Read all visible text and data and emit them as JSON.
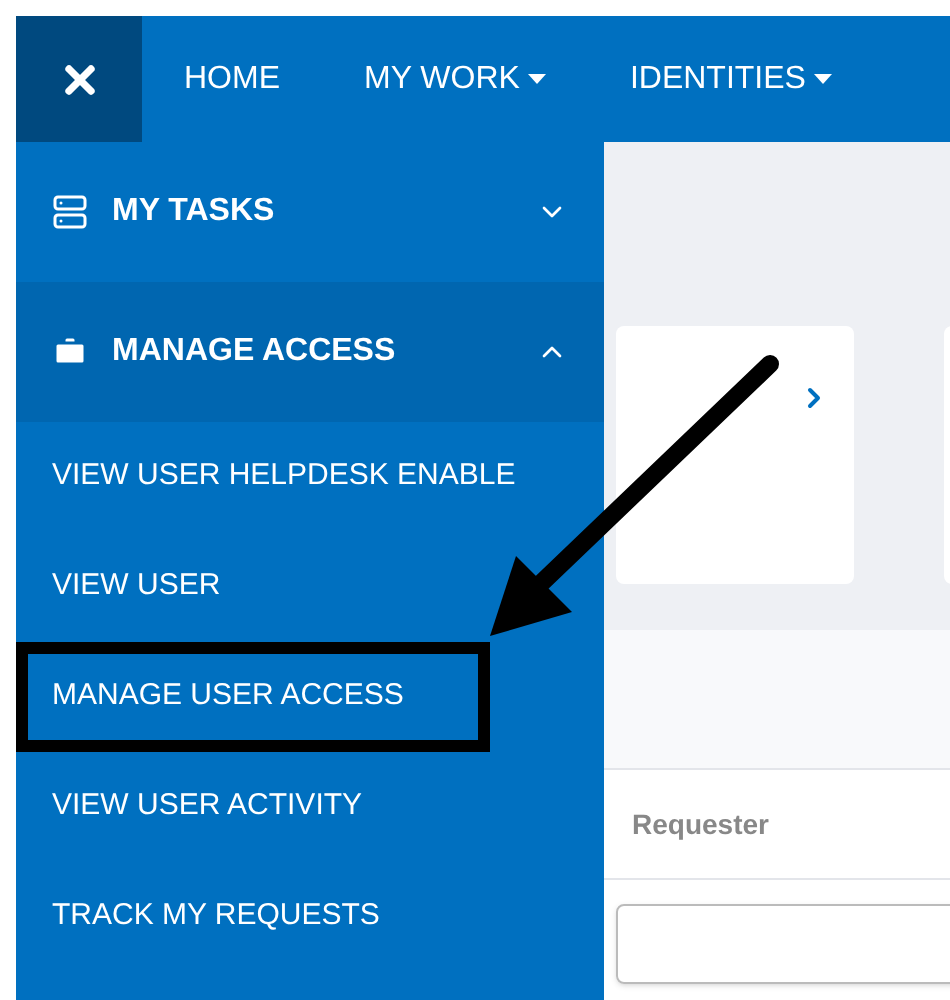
{
  "navbar": {
    "items": [
      {
        "label": "HOME",
        "dropdown": false
      },
      {
        "label": "MY WORK",
        "dropdown": true
      },
      {
        "label": "IDENTITIES",
        "dropdown": true
      }
    ]
  },
  "sidebar": {
    "sections": [
      {
        "label": "MY TASKS",
        "kind": "tasks",
        "expanded": false
      },
      {
        "label": "MANAGE ACCESS",
        "kind": "briefcase",
        "expanded": true,
        "items": [
          {
            "label": "VIEW USER HELPDESK ENABLE",
            "highlighted": false
          },
          {
            "label": "VIEW USER",
            "highlighted": false
          },
          {
            "label": "MANAGE USER ACCESS",
            "highlighted": true
          },
          {
            "label": "VIEW USER ACTIVITY",
            "highlighted": false
          },
          {
            "label": "TRACK MY REQUESTS",
            "highlighted": false
          }
        ]
      }
    ]
  },
  "table": {
    "columns": [
      "Requester"
    ]
  }
}
